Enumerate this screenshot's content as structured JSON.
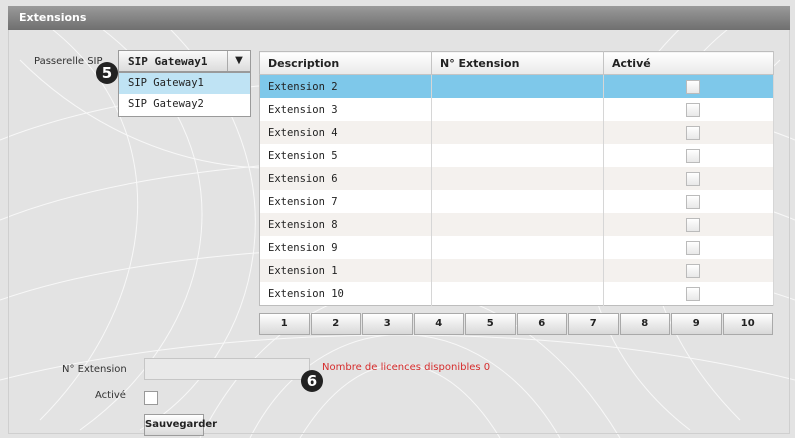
{
  "window": {
    "title": "Extensions"
  },
  "gateway": {
    "label": "Passerelle SIP",
    "selected": "SIP Gateway1",
    "arrow_icon": "▼",
    "options": [
      "SIP Gateway1",
      "SIP Gateway2"
    ]
  },
  "callouts": {
    "five": "5",
    "six": "6"
  },
  "table": {
    "headers": [
      "Description",
      "N° Extension",
      "Activé"
    ],
    "rows": [
      {
        "description": "Extension 2",
        "number": "",
        "active": false
      },
      {
        "description": "Extension 3",
        "number": "",
        "active": false
      },
      {
        "description": "Extension 4",
        "number": "",
        "active": false
      },
      {
        "description": "Extension 5",
        "number": "",
        "active": false
      },
      {
        "description": "Extension 6",
        "number": "",
        "active": false
      },
      {
        "description": "Extension 7",
        "number": "",
        "active": false
      },
      {
        "description": "Extension 8",
        "number": "",
        "active": false
      },
      {
        "description": "Extension 9",
        "number": "",
        "active": false
      },
      {
        "description": "Extension 1",
        "number": "",
        "active": false
      },
      {
        "description": "Extension 10",
        "number": "",
        "active": false
      }
    ]
  },
  "pager": [
    "1",
    "2",
    "3",
    "4",
    "5",
    "6",
    "7",
    "8",
    "9",
    "10"
  ],
  "form": {
    "extension_label": "N° Extension",
    "extension_value": "",
    "active_label": "Activé",
    "license_text": "Nombre de licences disponibles 0",
    "save_label": "Sauvegarder"
  },
  "colors": {
    "title_bar": "#7d7d7d",
    "selected_row": "#7ec8ea",
    "warning_text": "#d62c2c"
  }
}
